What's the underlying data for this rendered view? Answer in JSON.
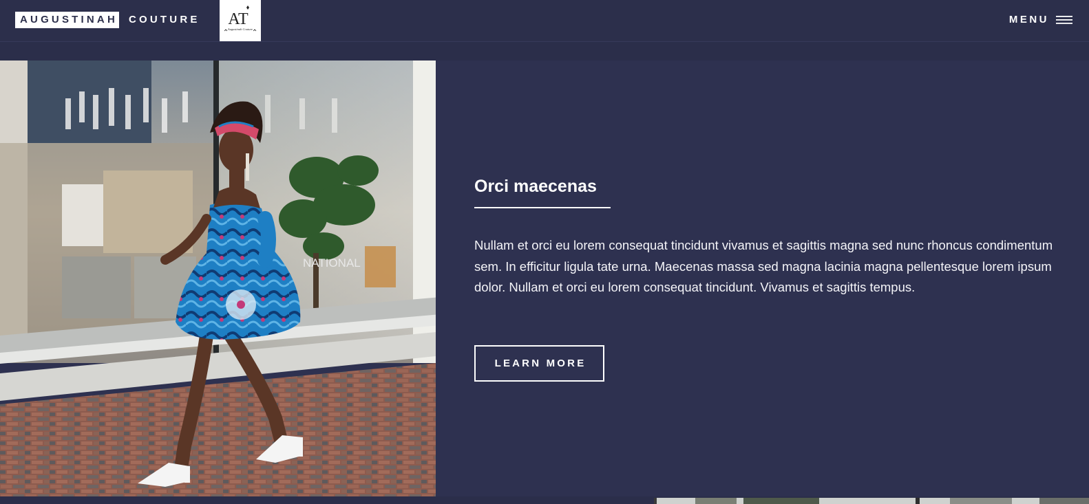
{
  "header": {
    "brand_primary": "AUGUSTINAH",
    "brand_secondary": "COUTURE",
    "logo_monogram": "AT",
    "logo_script": "Augustinah Couture",
    "menu_label": "MENU",
    "menu_icon": "hamburger-icon"
  },
  "hero": {
    "image_subject": "woman-in-blue-print-dress",
    "storefront_sign": "NATIONAL"
  },
  "feature": {
    "title": "Orci maecenas",
    "body": "Nullam et orci eu lorem consequat tincidunt vivamus et sagittis magna sed nunc rhoncus condimentum sem. In efficitur ligula tate urna. Maecenas massa sed magna lacinia magna pellentesque lorem ipsum dolor. Nullam et orci eu lorem consequat tincidunt. Vivamus et sagittis tempus.",
    "cta_label": "LEARN MORE"
  },
  "colors": {
    "background": "#2e3150",
    "header": "#2c2f4b",
    "text": "#ffffff",
    "accent_dress": "#1e7fc4"
  }
}
